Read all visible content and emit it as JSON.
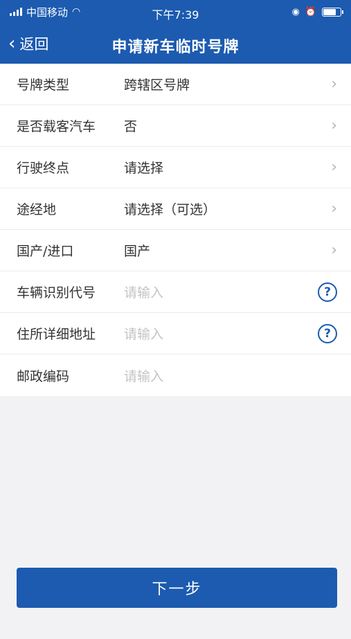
{
  "status": {
    "carrier": "中国移动",
    "time": "下午7:39",
    "wifi_icon": "wifi-icon",
    "battery_icon": "battery-icon"
  },
  "nav": {
    "back_label": "返回",
    "title": "申请新车临时号牌",
    "accent": "#1c5bb0"
  },
  "form": {
    "rows": [
      {
        "label": "号牌类型",
        "value": "跨辖区号牌",
        "placeholder": ""
      },
      {
        "label": "是否载客汽车",
        "value": "否",
        "placeholder": ""
      },
      {
        "label": "行驶终点",
        "value": "请选择",
        "placeholder": ""
      },
      {
        "label": "途经地",
        "value": "请选择（可选）",
        "placeholder": ""
      },
      {
        "label": "国产/进口",
        "value": "国产",
        "placeholder": ""
      },
      {
        "label": "车辆识别代号",
        "value": "",
        "placeholder": "请输入"
      },
      {
        "label": "住所详细地址",
        "value": "",
        "placeholder": "请输入"
      },
      {
        "label": "邮政编码",
        "value": "",
        "placeholder": "请输入"
      }
    ]
  },
  "footer": {
    "next_label": "下一步"
  }
}
